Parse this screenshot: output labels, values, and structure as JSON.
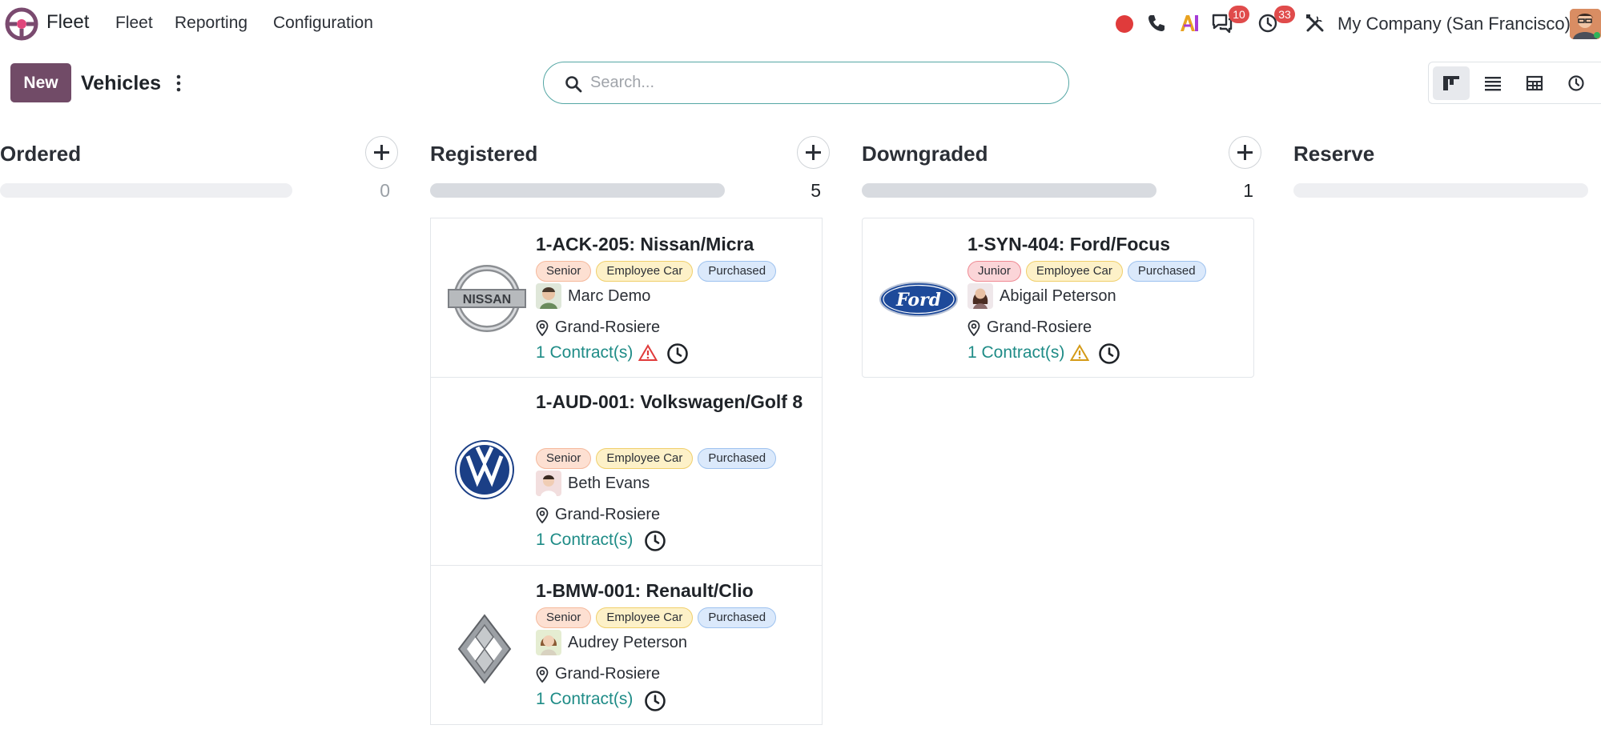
{
  "navbar": {
    "app_name": "Fleet",
    "menus": [
      "Fleet",
      "Reporting",
      "Configuration"
    ],
    "messages_badge": "10",
    "activities_badge": "33",
    "company": "My Company (San Francisco)"
  },
  "control_panel": {
    "new_label": "New",
    "title": "Vehicles",
    "search_placeholder": "Search..."
  },
  "columns": [
    {
      "title": "Ordered",
      "count": "0"
    },
    {
      "title": "Registered",
      "count": "5"
    },
    {
      "title": "Downgraded",
      "count": "1"
    },
    {
      "title": "Reserve"
    }
  ],
  "cards": [
    {
      "title": "1-ACK-205: Nissan/Micra",
      "logo": "nissan-logo",
      "tags": [
        "Senior",
        "Employee Car",
        "Purchased"
      ],
      "driver": "Marc Demo",
      "location": "Grand-Rosiere",
      "contracts": "1 Contract(s)",
      "warning_color": "#e03b3b"
    },
    {
      "title": "1-AUD-001: Volkswagen/Golf 8",
      "logo": "volkswagen-logo",
      "tags": [
        "Senior",
        "Employee Car",
        "Purchased"
      ],
      "driver": "Beth Evans",
      "location": "Grand-Rosiere",
      "contracts": "1 Contract(s)"
    },
    {
      "title": "1-BMW-001: Renault/Clio",
      "logo": "renault-logo",
      "tags": [
        "Senior",
        "Employee Car",
        "Purchased"
      ],
      "driver": "Audrey Peterson",
      "location": "Grand-Rosiere",
      "contracts": "1 Contract(s)"
    },
    {
      "title": "1-SYN-404: Ford/Focus",
      "logo": "ford-logo",
      "tags": [
        "Junior",
        "Employee Car",
        "Purchased"
      ],
      "driver": "Abigail Peterson",
      "location": "Grand-Rosiere",
      "contracts": "1 Contract(s)",
      "warning_color": "#d49a16"
    }
  ],
  "colors": {
    "brand": "#714b67",
    "link": "#1f8c87",
    "badge": "#e04b4b"
  }
}
